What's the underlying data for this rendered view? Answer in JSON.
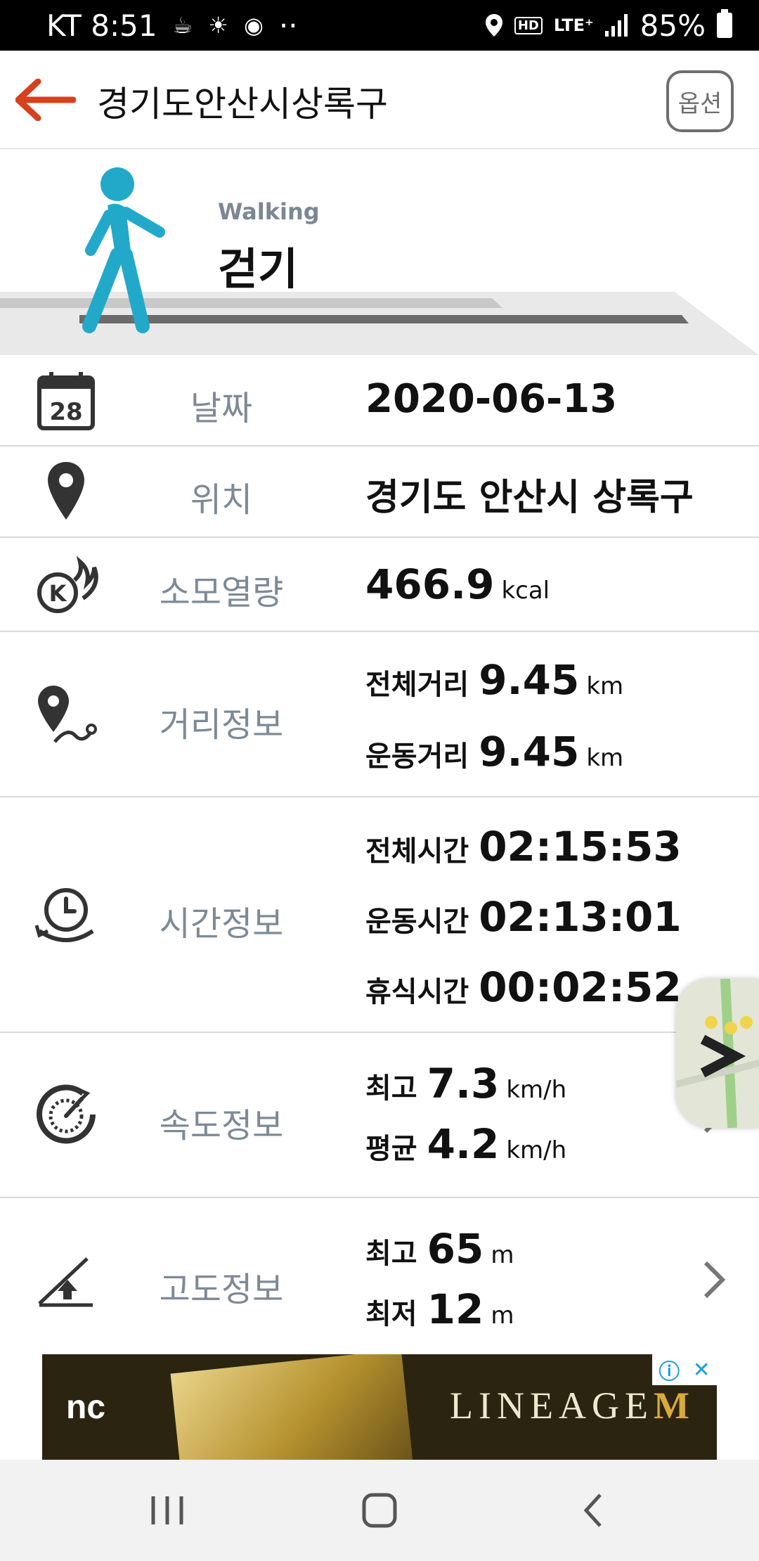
{
  "status_bar": {
    "carrier_time": "KT 8:51",
    "dots": "··",
    "hd": "HD",
    "lte": "LTE⁺",
    "battery": "85%"
  },
  "header": {
    "title": "경기도안산시상록구",
    "option_label": "옵션"
  },
  "activity": {
    "name_en": "Walking",
    "name_ko": "걷기"
  },
  "rows": {
    "date": {
      "label": "날짜",
      "icon_day": "28",
      "value": "2020-06-13"
    },
    "location": {
      "label": "위치",
      "value": "경기도 안산시 상록구"
    },
    "calories": {
      "label": "소모열량",
      "value": "466.9",
      "unit": "kcal"
    },
    "distance": {
      "label": "거리정보",
      "items": [
        {
          "key": "전체거리",
          "value": "9.45",
          "unit": "km"
        },
        {
          "key": "운동거리",
          "value": "9.45",
          "unit": "km"
        }
      ]
    },
    "time": {
      "label": "시간정보",
      "items": [
        {
          "key": "전체시간",
          "value": "02:15:53"
        },
        {
          "key": "운동시간",
          "value": "02:13:01"
        },
        {
          "key": "휴식시간",
          "value": "00:02:52"
        }
      ]
    },
    "speed": {
      "label": "속도정보",
      "items": [
        {
          "key": "최고",
          "value": "7.3",
          "unit": "km/h"
        },
        {
          "key": "평균",
          "value": "4.2",
          "unit": "km/h"
        }
      ]
    },
    "altitude": {
      "label": "고도정보",
      "items": [
        {
          "key": "최고",
          "value": "65",
          "unit": "m"
        },
        {
          "key": "최저",
          "value": "12",
          "unit": "m"
        }
      ]
    }
  },
  "ad": {
    "logo": "nc",
    "brand": "LINEAGE",
    "brand_m": "M"
  },
  "colors": {
    "accent_orange": "#d6401b",
    "walker_teal": "#22a9c9",
    "label_gray": "#7d8a96"
  }
}
